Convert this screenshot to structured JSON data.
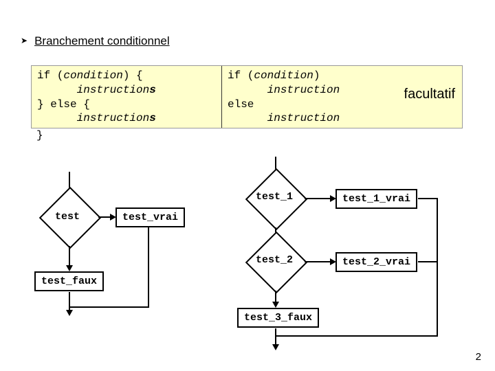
{
  "heading": "Branchement conditionnel",
  "code_left": {
    "l1a": "if (",
    "l1b": "condition",
    "l1c": ") {",
    "l2a": "      ",
    "l2b": "instruction",
    "l2c": "s",
    "l3a": "} else {",
    "l4a": "      ",
    "l4b": "instruction",
    "l4c": "s",
    "l5": "}"
  },
  "code_right": {
    "l1a": "if (",
    "l1b": "condition",
    "l1c": ")",
    "l2a": "      ",
    "l2b": "instruction",
    "l3a": "else",
    "l4a": "      ",
    "l4b": "instruction"
  },
  "facultatif": "facultatif",
  "flow_left": {
    "test": "test",
    "test_vrai": "test_vrai",
    "test_faux": "test_faux"
  },
  "flow_right": {
    "test_1": "test_1",
    "test_1_vrai": "test_1_vrai",
    "test_2": "test_2",
    "test_2_vrai": "test_2_vrai",
    "test_3_faux": "test_3_faux"
  },
  "page_number": "2"
}
